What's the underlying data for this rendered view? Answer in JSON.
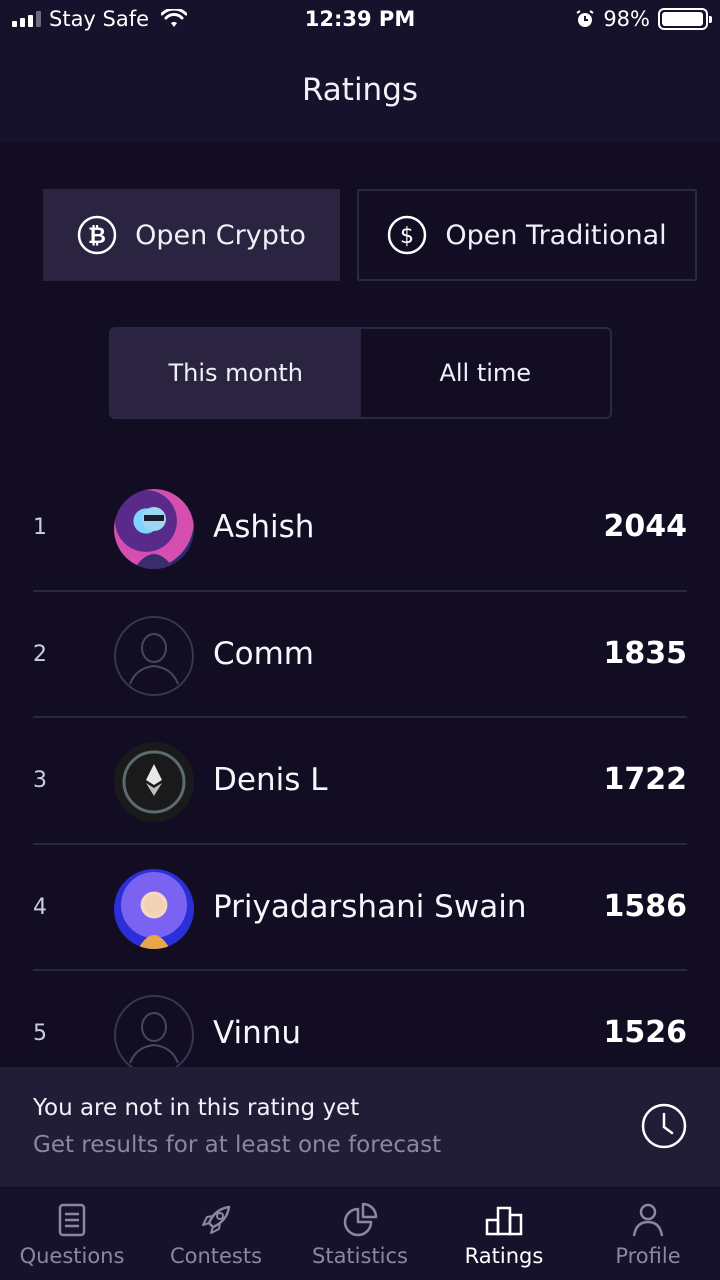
{
  "status_bar": {
    "carrier": "Stay Safe",
    "time": "12:39 PM",
    "battery": "98%"
  },
  "header": {
    "title": "Ratings"
  },
  "categories": [
    {
      "label": "Open Crypto",
      "icon": "bitcoin-icon",
      "active": true
    },
    {
      "label": "Open Traditional",
      "icon": "dollar-icon",
      "active": false
    }
  ],
  "periods": [
    {
      "label": "This month",
      "active": true
    },
    {
      "label": "All time",
      "active": false
    }
  ],
  "leaderboard": [
    {
      "rank": "1",
      "name": "Ashish",
      "score": "2044",
      "avatar": "photo"
    },
    {
      "rank": "2",
      "name": "Comm",
      "score": "1835",
      "avatar": "placeholder"
    },
    {
      "rank": "3",
      "name": "Denis L",
      "score": "1722",
      "avatar": "photo"
    },
    {
      "rank": "4",
      "name": "Priyadarshani Swain",
      "score": "1586",
      "avatar": "photo"
    },
    {
      "rank": "5",
      "name": "Vinnu",
      "score": "1526",
      "avatar": "placeholder"
    }
  ],
  "notice": {
    "title": "You are not in this rating yet",
    "subtitle": "Get results for at least one forecast",
    "icon": "clock-icon"
  },
  "tabbar": [
    {
      "label": "Questions",
      "icon": "document-icon",
      "active": false
    },
    {
      "label": "Contests",
      "icon": "rocket-icon",
      "active": false
    },
    {
      "label": "Statistics",
      "icon": "pie-chart-icon",
      "active": false
    },
    {
      "label": "Ratings",
      "icon": "podium-icon",
      "active": true
    },
    {
      "label": "Profile",
      "icon": "person-icon",
      "active": false
    }
  ],
  "colors": {
    "background": "#120d23",
    "surface": "#17122b",
    "active_surface": "#2a2440",
    "muted_text": "#8b87a0"
  }
}
